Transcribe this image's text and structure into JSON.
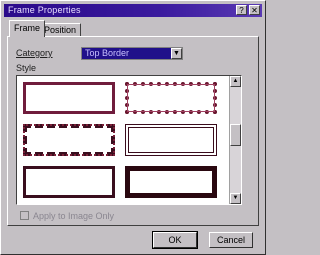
{
  "window": {
    "title": "Frame Properties",
    "help_glyph": "?",
    "close_glyph": "✕"
  },
  "tabs": [
    {
      "label": "Frame",
      "active": true
    },
    {
      "label": "Position",
      "active": false
    }
  ],
  "category": {
    "label": "Category",
    "value": "Top Border"
  },
  "style": {
    "label": "Style",
    "options": [
      "plain",
      "wavy",
      "zigzag",
      "double",
      "stamp",
      "thick"
    ]
  },
  "apply_all": {
    "label": "Apply to Image Only",
    "checked": false
  },
  "buttons": {
    "ok": "OK",
    "cancel": "Cancel"
  },
  "colors": {
    "titlebar": "#2a0a8a",
    "frame_accent": "#701c3c",
    "dialog_face": "#c4c0c4"
  }
}
